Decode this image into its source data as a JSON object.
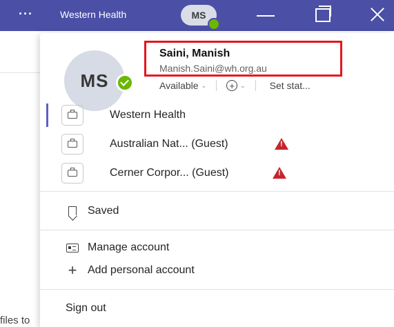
{
  "titlebar": {
    "more_label": "···",
    "org_name": "Western Health",
    "avatar_initials": "MS"
  },
  "background": {
    "partial_text": "files to"
  },
  "profile": {
    "initials": "MS",
    "name": "Saini, Manish",
    "email": "Manish.Saini@wh.org.au",
    "status_label": "Available",
    "status_note_label": "Set stat...",
    "status_color": "#6bb700"
  },
  "organizations": [
    {
      "label": "Western Health",
      "active": true,
      "warning": false
    },
    {
      "label": "Australian Nat... (Guest)",
      "active": false,
      "warning": true
    },
    {
      "label": "Cerner Corpor... (Guest)",
      "active": false,
      "warning": true
    }
  ],
  "menu": {
    "saved_label": "Saved",
    "manage_account_label": "Manage account",
    "add_personal_account_label": "Add personal account",
    "sign_out_label": "Sign out"
  },
  "colors": {
    "titlebar_bg": "#4b4fa6",
    "accent": "#5b5fc7",
    "warning": "#c4262e",
    "highlight_border": "#e8141e"
  }
}
